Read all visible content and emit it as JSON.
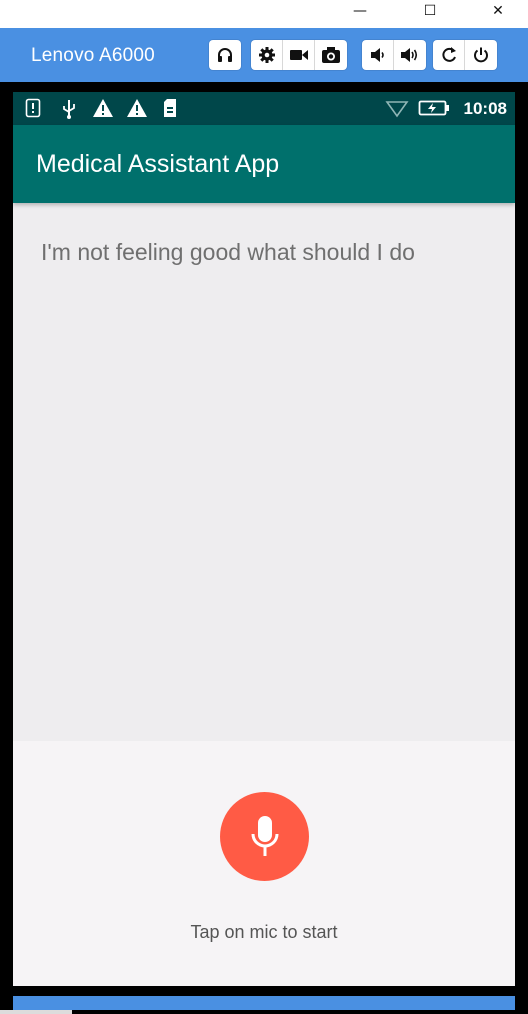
{
  "window": {
    "minimize_glyph": "—",
    "maximize_glyph": "☐",
    "close_glyph": "✕"
  },
  "toolbar": {
    "device_name": "Lenovo A6000",
    "groups": [
      {
        "icons": [
          "headphones-icon"
        ]
      },
      {
        "icons": [
          "gear-icon",
          "video-camera-icon",
          "camera-icon"
        ]
      },
      {
        "icons": [
          "volume-down-icon",
          "volume-up-icon"
        ]
      },
      {
        "icons": [
          "rotate-icon",
          "power-icon"
        ]
      }
    ]
  },
  "status_bar": {
    "icons": [
      "alert-icon",
      "usb-icon",
      "warning-icon",
      "warning-icon",
      "sd-card-icon",
      "wifi-icon",
      "battery-charging-icon"
    ],
    "time": "10:08"
  },
  "app": {
    "title": "Medical Assistant App",
    "speech_text": "I'm not feeling good what should I do",
    "mic_hint": "Tap on mic to start",
    "colors": {
      "status_bar": "#00474a",
      "app_bar": "#00706c",
      "mic_button": "#ff5b45",
      "toolbar": "#4a90e2"
    }
  }
}
